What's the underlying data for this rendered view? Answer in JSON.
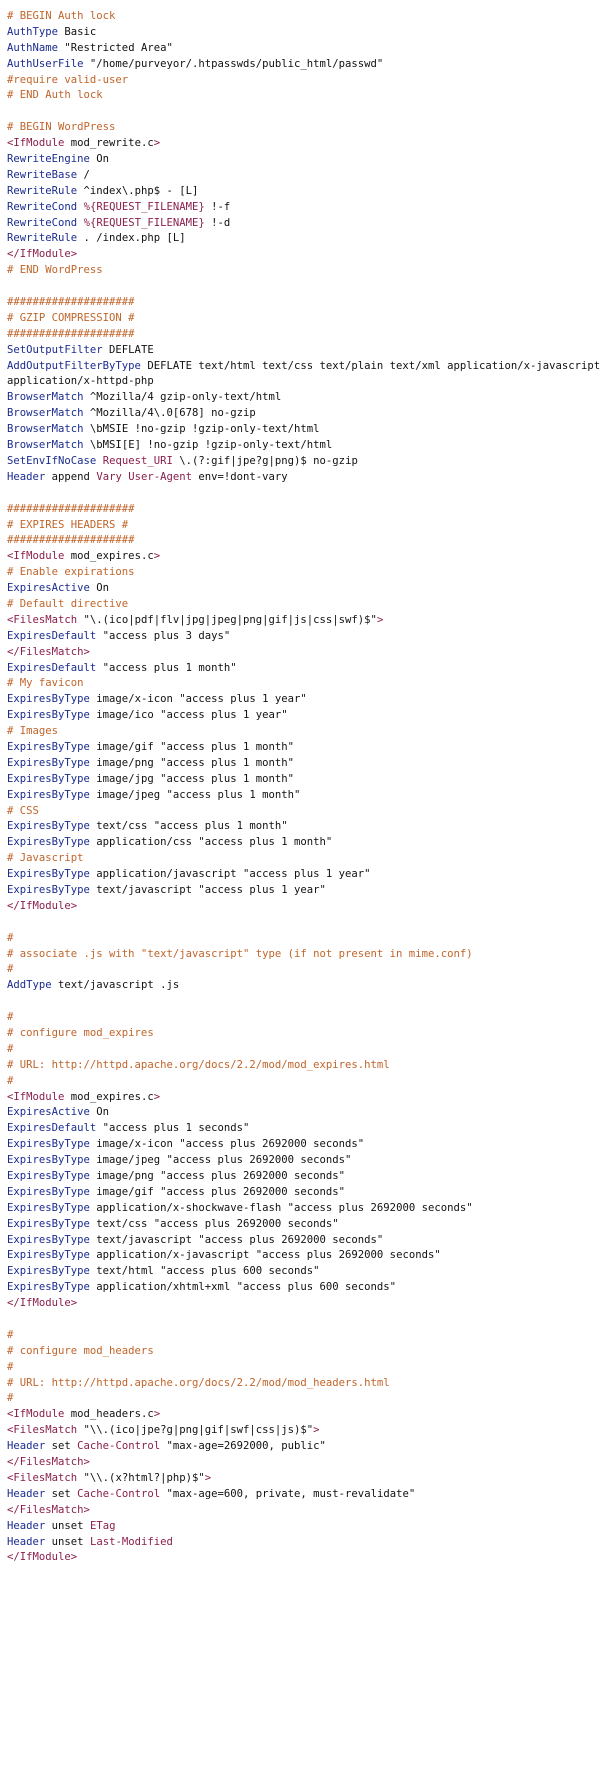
{
  "document": {
    "colors": {
      "comment": "#c0652b",
      "directive": "#1b2c8f",
      "variable": "#8a1f4d",
      "tag": "#8a1f4d",
      "text": "#111111",
      "background": "#ffffff"
    },
    "lines": [
      [
        [
          "c",
          "# BEGIN Auth lock"
        ]
      ],
      [
        [
          "d",
          "AuthType"
        ],
        [
          "p",
          " Basic"
        ]
      ],
      [
        [
          "d",
          "AuthName"
        ],
        [
          "p",
          " \"Restricted Area\""
        ]
      ],
      [
        [
          "d",
          "AuthUserFile"
        ],
        [
          "p",
          " \"/home/purveyor/.htpasswds/public_html/passwd\""
        ]
      ],
      [
        [
          "c",
          "#require valid-user"
        ]
      ],
      [
        [
          "c",
          "# END Auth lock"
        ]
      ],
      [],
      [
        [
          "c",
          "# BEGIN WordPress"
        ]
      ],
      [
        [
          "t",
          "<IfModule"
        ],
        [
          "p",
          " mod_rewrite.c"
        ],
        [
          "t",
          ">"
        ]
      ],
      [
        [
          "d",
          "RewriteEngine"
        ],
        [
          "p",
          " On"
        ]
      ],
      [
        [
          "d",
          "RewriteBase"
        ],
        [
          "p",
          " /"
        ]
      ],
      [
        [
          "d",
          "RewriteRule"
        ],
        [
          "p",
          " ^index\\.php$ - [L]"
        ]
      ],
      [
        [
          "d",
          "RewriteCond"
        ],
        [
          "p",
          " "
        ],
        [
          "v",
          "%{REQUEST_FILENAME}"
        ],
        [
          "p",
          " !-f"
        ]
      ],
      [
        [
          "d",
          "RewriteCond"
        ],
        [
          "p",
          " "
        ],
        [
          "v",
          "%{REQUEST_FILENAME}"
        ],
        [
          "p",
          " !-d"
        ]
      ],
      [
        [
          "d",
          "RewriteRule"
        ],
        [
          "p",
          " . /index.php [L]"
        ]
      ],
      [
        [
          "t",
          "</IfModule>"
        ]
      ],
      [
        [
          "c",
          "# END WordPress"
        ]
      ],
      [],
      [
        [
          "c",
          "####################"
        ]
      ],
      [
        [
          "c",
          "# GZIP COMPRESSION #"
        ]
      ],
      [
        [
          "c",
          "####################"
        ]
      ],
      [
        [
          "d",
          "SetOutputFilter"
        ],
        [
          "p",
          " DEFLATE"
        ]
      ],
      [
        [
          "d",
          "AddOutputFilterByType"
        ],
        [
          "p",
          " DEFLATE text/html text/css text/plain text/xml application/x-javascript"
        ]
      ],
      [
        [
          "p",
          "application/x-httpd-php"
        ]
      ],
      [
        [
          "d",
          "BrowserMatch"
        ],
        [
          "p",
          " ^Mozilla/4 gzip-only-text/html"
        ]
      ],
      [
        [
          "d",
          "BrowserMatch"
        ],
        [
          "p",
          " ^Mozilla/4\\.0[678] no-gzip"
        ]
      ],
      [
        [
          "d",
          "BrowserMatch"
        ],
        [
          "p",
          " \\bMSIE !no-gzip !gzip-only-text/html"
        ]
      ],
      [
        [
          "d",
          "BrowserMatch"
        ],
        [
          "p",
          " \\bMSI[E] !no-gzip !gzip-only-text/html"
        ]
      ],
      [
        [
          "d",
          "SetEnvIfNoCase"
        ],
        [
          "p",
          " "
        ],
        [
          "v",
          "Request_URI"
        ],
        [
          "p",
          " \\.(?:gif|jpe?g|png)$ no-gzip"
        ]
      ],
      [
        [
          "d",
          "Header"
        ],
        [
          "p",
          " append "
        ],
        [
          "v",
          "Vary"
        ],
        [
          "p",
          " "
        ],
        [
          "v",
          "User-Agent"
        ],
        [
          "p",
          " env=!dont-vary"
        ]
      ],
      [],
      [
        [
          "c",
          "####################"
        ]
      ],
      [
        [
          "c",
          "# EXPIRES HEADERS #"
        ]
      ],
      [
        [
          "c",
          "####################"
        ]
      ],
      [
        [
          "t",
          "<IfModule"
        ],
        [
          "p",
          " mod_expires.c"
        ],
        [
          "t",
          ">"
        ]
      ],
      [
        [
          "c",
          "# Enable expirations"
        ]
      ],
      [
        [
          "d",
          "ExpiresActive"
        ],
        [
          "p",
          " On"
        ]
      ],
      [
        [
          "c",
          "# Default directive"
        ]
      ],
      [
        [
          "t",
          "<FilesMatch"
        ],
        [
          "p",
          " \"\\.(ico|pdf|flv|jpg|jpeg|png|gif|js|css|swf)$\""
        ],
        [
          "t",
          ">"
        ]
      ],
      [
        [
          "d",
          "ExpiresDefault"
        ],
        [
          "p",
          " \"access plus 3 days\""
        ]
      ],
      [
        [
          "t",
          "</FilesMatch>"
        ]
      ],
      [
        [
          "d",
          "ExpiresDefault"
        ],
        [
          "p",
          " \"access plus 1 month\""
        ]
      ],
      [
        [
          "c",
          "# My favicon"
        ]
      ],
      [
        [
          "d",
          "ExpiresByType"
        ],
        [
          "p",
          " image/x-icon \"access plus 1 year\""
        ]
      ],
      [
        [
          "d",
          "ExpiresByType"
        ],
        [
          "p",
          " image/ico \"access plus 1 year\""
        ]
      ],
      [
        [
          "c",
          "# Images"
        ]
      ],
      [
        [
          "d",
          "ExpiresByType"
        ],
        [
          "p",
          " image/gif \"access plus 1 month\""
        ]
      ],
      [
        [
          "d",
          "ExpiresByType"
        ],
        [
          "p",
          " image/png \"access plus 1 month\""
        ]
      ],
      [
        [
          "d",
          "ExpiresByType"
        ],
        [
          "p",
          " image/jpg \"access plus 1 month\""
        ]
      ],
      [
        [
          "d",
          "ExpiresByType"
        ],
        [
          "p",
          " image/jpeg \"access plus 1 month\""
        ]
      ],
      [
        [
          "c",
          "# CSS"
        ]
      ],
      [
        [
          "d",
          "ExpiresByType"
        ],
        [
          "p",
          " text/css \"access plus 1 month\""
        ]
      ],
      [
        [
          "d",
          "ExpiresByType"
        ],
        [
          "p",
          " application/css \"access plus 1 month\""
        ]
      ],
      [
        [
          "c",
          "# Javascript"
        ]
      ],
      [
        [
          "d",
          "ExpiresByType"
        ],
        [
          "p",
          " application/javascript \"access plus 1 year\""
        ]
      ],
      [
        [
          "d",
          "ExpiresByType"
        ],
        [
          "p",
          " text/javascript \"access plus 1 year\""
        ]
      ],
      [
        [
          "t",
          "</IfModule>"
        ]
      ],
      [],
      [
        [
          "c",
          "#"
        ]
      ],
      [
        [
          "c",
          "# associate .js with \"text/javascript\" type (if not present in mime.conf)"
        ]
      ],
      [
        [
          "c",
          "#"
        ]
      ],
      [
        [
          "d",
          "AddType"
        ],
        [
          "p",
          " text/javascript .js"
        ]
      ],
      [],
      [
        [
          "c",
          "#"
        ]
      ],
      [
        [
          "c",
          "# configure mod_expires"
        ]
      ],
      [
        [
          "c",
          "#"
        ]
      ],
      [
        [
          "c",
          "# URL: http://httpd.apache.org/docs/2.2/mod/mod_expires.html"
        ]
      ],
      [
        [
          "c",
          "#"
        ]
      ],
      [
        [
          "t",
          "<IfModule"
        ],
        [
          "p",
          " mod_expires.c"
        ],
        [
          "t",
          ">"
        ]
      ],
      [
        [
          "d",
          "ExpiresActive"
        ],
        [
          "p",
          " On"
        ]
      ],
      [
        [
          "d",
          "ExpiresDefault"
        ],
        [
          "p",
          " \"access plus 1 seconds\""
        ]
      ],
      [
        [
          "d",
          "ExpiresByType"
        ],
        [
          "p",
          " image/x-icon \"access plus 2692000 seconds\""
        ]
      ],
      [
        [
          "d",
          "ExpiresByType"
        ],
        [
          "p",
          " image/jpeg \"access plus 2692000 seconds\""
        ]
      ],
      [
        [
          "d",
          "ExpiresByType"
        ],
        [
          "p",
          " image/png \"access plus 2692000 seconds\""
        ]
      ],
      [
        [
          "d",
          "ExpiresByType"
        ],
        [
          "p",
          " image/gif \"access plus 2692000 seconds\""
        ]
      ],
      [
        [
          "d",
          "ExpiresByType"
        ],
        [
          "p",
          " application/x-shockwave-flash \"access plus 2692000 seconds\""
        ]
      ],
      [
        [
          "d",
          "ExpiresByType"
        ],
        [
          "p",
          " text/css \"access plus 2692000 seconds\""
        ]
      ],
      [
        [
          "d",
          "ExpiresByType"
        ],
        [
          "p",
          " text/javascript \"access plus 2692000 seconds\""
        ]
      ],
      [
        [
          "d",
          "ExpiresByType"
        ],
        [
          "p",
          " application/x-javascript \"access plus 2692000 seconds\""
        ]
      ],
      [
        [
          "d",
          "ExpiresByType"
        ],
        [
          "p",
          " text/html \"access plus 600 seconds\""
        ]
      ],
      [
        [
          "d",
          "ExpiresByType"
        ],
        [
          "p",
          " application/xhtml+xml \"access plus 600 seconds\""
        ]
      ],
      [
        [
          "t",
          "</IfModule>"
        ]
      ],
      [],
      [
        [
          "c",
          "#"
        ]
      ],
      [
        [
          "c",
          "# configure mod_headers"
        ]
      ],
      [
        [
          "c",
          "#"
        ]
      ],
      [
        [
          "c",
          "# URL: http://httpd.apache.org/docs/2.2/mod/mod_headers.html"
        ]
      ],
      [
        [
          "c",
          "#"
        ]
      ],
      [
        [
          "t",
          "<IfModule"
        ],
        [
          "p",
          " mod_headers.c"
        ],
        [
          "t",
          ">"
        ]
      ],
      [
        [
          "t",
          "<FilesMatch"
        ],
        [
          "p",
          " \"\\\\.(ico|jpe?g|png|gif|swf|css|js)$\""
        ],
        [
          "t",
          ">"
        ]
      ],
      [
        [
          "d",
          "Header"
        ],
        [
          "p",
          " set "
        ],
        [
          "v",
          "Cache-Control"
        ],
        [
          "p",
          " \"max-age=2692000, public\""
        ]
      ],
      [
        [
          "t",
          "</FilesMatch>"
        ]
      ],
      [
        [
          "t",
          "<FilesMatch"
        ],
        [
          "p",
          " \"\\\\.(x?html?|php)$\""
        ],
        [
          "t",
          ">"
        ]
      ],
      [
        [
          "d",
          "Header"
        ],
        [
          "p",
          " set "
        ],
        [
          "v",
          "Cache-Control"
        ],
        [
          "p",
          " \"max-age=600, private, must-revalidate\""
        ]
      ],
      [
        [
          "t",
          "</FilesMatch>"
        ]
      ],
      [
        [
          "d",
          "Header"
        ],
        [
          "p",
          " unset "
        ],
        [
          "v",
          "ETag"
        ]
      ],
      [
        [
          "d",
          "Header"
        ],
        [
          "p",
          " unset "
        ],
        [
          "v",
          "Last-Modified"
        ]
      ],
      [
        [
          "t",
          "</IfModule>"
        ]
      ]
    ]
  }
}
